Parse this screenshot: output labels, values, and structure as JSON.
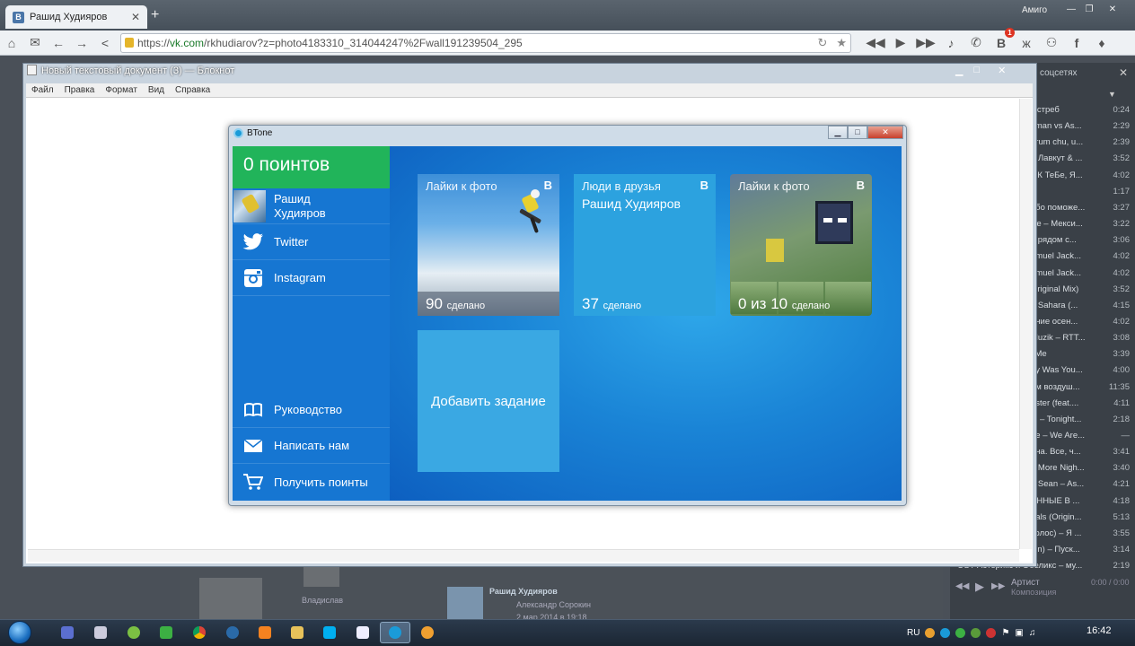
{
  "browser": {
    "tab_title": "Рашид Худияров",
    "user": "Амиго",
    "url_prefix": "https://",
    "url_host": "vk.com",
    "url_path": "/rkhudiarov?z=photo4183310_314044247%2Fwall191239504_295",
    "notification_count": "1",
    "toolbar_icons": [
      "home-icon",
      "mail-icon",
      "back-icon",
      "forward-icon",
      "share-icon"
    ],
    "media_icons": [
      "prev-icon",
      "play-icon",
      "next-icon",
      "music-note-icon",
      "chat-icon",
      "vk-icon",
      "odnoklassniki-icon",
      "friends-icon",
      "facebook-icon",
      "twitter-icon"
    ]
  },
  "notepad": {
    "title": "Новый текстовый документ (3) — Блокнот",
    "menu": [
      "Файл",
      "Правка",
      "Формат",
      "Вид",
      "Справка"
    ]
  },
  "btone": {
    "title": "BTone",
    "points_label": "0 поинтов",
    "profile_name": "Рашид Худияров",
    "sidebar_top": [
      {
        "label": "Twitter",
        "icon": "twitter-icon"
      },
      {
        "label": "Instagram",
        "icon": "instagram-icon"
      }
    ],
    "sidebar_bottom": [
      {
        "label": "Руководство",
        "icon": "book-icon"
      },
      {
        "label": "Написать нам",
        "icon": "envelope-icon"
      },
      {
        "label": "Получить поинты",
        "icon": "cart-icon"
      }
    ],
    "tiles": [
      {
        "title": "Лайки к фото",
        "badge": "B",
        "count": "90",
        "count_label": "сделано"
      },
      {
        "title": "Люди в друзья",
        "subtitle": "Рашид Худияров",
        "badge": "B",
        "count": "37",
        "count_label": "сделано"
      },
      {
        "title": "Лайки к фото",
        "badge": "B",
        "count": "0 из 10",
        "count_label": "сделано"
      }
    ],
    "add_task_label": "Добавить задание",
    "accent_green": "#21b45a",
    "accent_blue": "#1676d2"
  },
  "music_panel": {
    "header": "соцсетях",
    "tracks": [
      {
        "title": "Ястреб",
        "duration": "0:24"
      },
      {
        "title": "itman vs As...",
        "duration": "2:29"
      },
      {
        "title": "urum chu, u...",
        "duration": "2:39"
      },
      {
        "title": "й Лавкут & ...",
        "duration": "3:52"
      },
      {
        "title": "у К ТеБе, Я...",
        "duration": "4:02"
      },
      {
        "title": "",
        "duration": "1:17"
      },
      {
        "title": "ебо поможе...",
        "duration": "3:27"
      },
      {
        "title": "же – Мекси...",
        "duration": "3:22"
      },
      {
        "title": "я рядом с...",
        "duration": "3:06"
      },
      {
        "title": "amuel Jack...",
        "duration": "4:02"
      },
      {
        "title": "amuel Jack...",
        "duration": "4:02"
      },
      {
        "title": "Original Mix)",
        "duration": "3:52"
      },
      {
        "title": "– Sahara (...",
        "duration": "4:15"
      },
      {
        "title": "ение осен...",
        "duration": "4:02"
      },
      {
        "title": "Muzik – RTT...",
        "duration": "3:08"
      },
      {
        "title": "' Me",
        "duration": "3:39"
      },
      {
        "title": "ay Was You...",
        "duration": "4:00"
      },
      {
        "title": "ем воздуш...",
        "duration": "11:35"
      },
      {
        "title": "nster (feat....",
        "duration": "4:11"
      },
      {
        "title": "ie – Tonight...",
        "duration": "2:18"
      },
      {
        "title": "ае – We Are...",
        "duration": "—"
      },
      {
        "title": "ана. Все, ч...",
        "duration": "3:41"
      },
      {
        "title": "e More Nigh...",
        "duration": "3:40"
      },
      {
        "title": "g Sean – As...",
        "duration": "4:21"
      },
      {
        "title": "ЕННЫЕ В ...",
        "duration": "4:18"
      },
      {
        "title": "nals (Origin...",
        "duration": "5:13"
      },
      {
        "title": "Голос) – Я ...",
        "duration": "3:55"
      },
      {
        "title": "ion) – Пуск...",
        "duration": "3:14"
      },
      {
        "title": "OST Астерикс и Обеликс – му...",
        "duration": "2:19"
      }
    ],
    "player_artist": "Артист",
    "player_track": "Композиция",
    "player_time": "0:00 / 0:00"
  },
  "feed": {
    "name1": "Владислав",
    "author": "Рашид Худияров",
    "reposter": "Александр Сорокин",
    "date": "2 мар 2014 в 19:18"
  },
  "taskbar": {
    "lang": "RU",
    "time": "16:42"
  }
}
